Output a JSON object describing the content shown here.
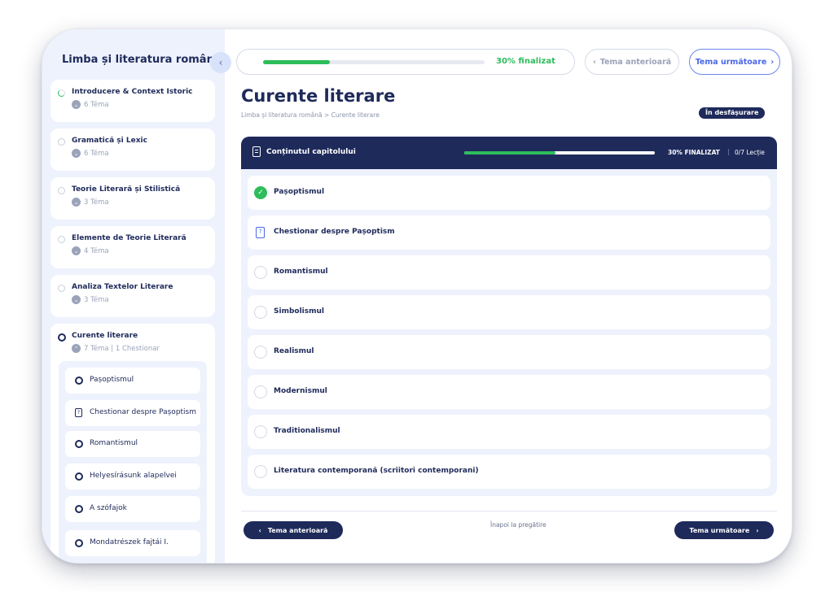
{
  "sidebar": {
    "title": "Limba și literatura română",
    "collapse_icon": "‹",
    "chapters": [
      {
        "title": "Introducere & Context Istoric",
        "meta": "6 Téma"
      },
      {
        "title": "Gramatică și Lexic",
        "meta": "6 Téma"
      },
      {
        "title": "Teorie Literară și Stilistică",
        "meta": "3 Téma"
      },
      {
        "title": "Elemente de Teorie Literară",
        "meta": "4 Téma"
      },
      {
        "title": "Analiza Textelor Literare",
        "meta": "3 Téma"
      }
    ],
    "expanded": {
      "title": "Curente literare",
      "meta": "7 Téma | 1 Chestionar",
      "items": [
        {
          "label": "Pașoptismul"
        },
        {
          "label": "Chestionar despre Pașoptism"
        },
        {
          "label": "Romantismul"
        },
        {
          "label": "Helyesírásunk alapelvei"
        },
        {
          "label": "A szófajok"
        },
        {
          "label": "Mondatrészek fajtái I."
        }
      ]
    }
  },
  "topbar": {
    "progress_percent": 30,
    "progress_text": "30% finalizat",
    "prev_label": "Tema anterioară",
    "next_label": "Tema următoare"
  },
  "main": {
    "title": "Curente literare",
    "breadcrumb": "Limba și literatura română > Curente literare",
    "status": "În desfășurare"
  },
  "content": {
    "header_title": "Conținutul capitolului",
    "progress_percent": 30,
    "progress_text": "30% FINALIZAT",
    "separator": "|",
    "count_text": "0/7 Lecție",
    "lessons": [
      {
        "label": "Pașoptismul",
        "status": "done"
      },
      {
        "label": "Chestionar despre Pașoptism",
        "status": "quiz"
      },
      {
        "label": "Romantismul",
        "status": "todo"
      },
      {
        "label": "Simbolismul",
        "status": "todo"
      },
      {
        "label": "Realismul",
        "status": "todo"
      },
      {
        "label": "Modernismul",
        "status": "todo"
      },
      {
        "label": "Traditionalismul",
        "status": "todo"
      },
      {
        "label": "Literatura contemporană (scriitori contemporani)",
        "status": "todo"
      }
    ]
  },
  "footer": {
    "prev_label": "Tema anterioară",
    "back_label": "Înapoi la pregătire",
    "next_label": "Tema următoare"
  },
  "colors": {
    "navy": "#1e2a5a",
    "green": "#2dbd5b",
    "accent": "#4a67e8",
    "sidebar_bg": "#eef2fd"
  }
}
